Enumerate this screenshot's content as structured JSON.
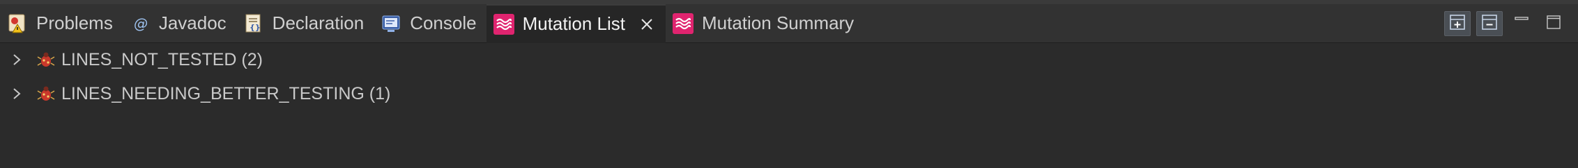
{
  "tabs": [
    {
      "label": "Problems",
      "icon": "problems-icon",
      "active": false
    },
    {
      "label": "Javadoc",
      "icon": "at-icon",
      "active": false
    },
    {
      "label": "Declaration",
      "icon": "declaration-icon",
      "active": false
    },
    {
      "label": "Console",
      "icon": "console-icon",
      "active": false
    },
    {
      "label": "Mutation List",
      "icon": "mutation-wave-icon",
      "active": true
    },
    {
      "label": "Mutation Summary",
      "icon": "mutation-wave-icon",
      "active": false
    }
  ],
  "window_controls": [
    "expand-all-icon",
    "collapse-all-icon",
    "minimize-icon",
    "maximize-icon"
  ],
  "tree": [
    {
      "label": "LINES_NOT_TESTED (2)",
      "icon": "bug-icon"
    },
    {
      "label": "LINES_NEEDING_BETTER_TESTING (1)",
      "icon": "bug-icon"
    }
  ],
  "colors": {
    "accent": "#e0246f",
    "background": "#2b2b2b",
    "tab_bar": "#323232"
  }
}
